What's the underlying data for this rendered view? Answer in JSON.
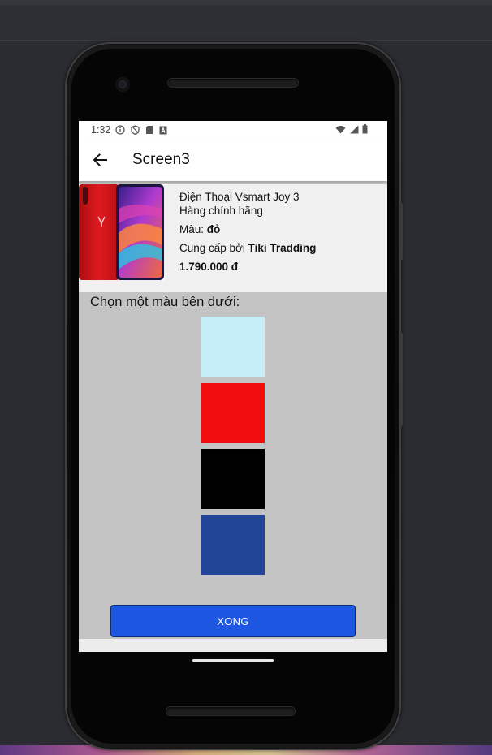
{
  "status_bar": {
    "time": "1:32",
    "left_icons": [
      "info-icon",
      "shield-icon",
      "sd-card-icon",
      "a-badge-icon"
    ],
    "right_icons": [
      "wifi-icon",
      "signal-icon",
      "battery-icon"
    ]
  },
  "app_bar": {
    "title": "Screen3",
    "back_icon": "arrow-left-icon"
  },
  "product": {
    "name": "Điện Thoại Vsmart Joy 3",
    "subtitle": "Hàng chính hãng",
    "color_label": "Màu: ",
    "color_value": "đỏ",
    "supplier_label": "Cung cấp bởi ",
    "supplier_value": "Tiki Tradding",
    "price": "1.790.000 đ"
  },
  "picker": {
    "prompt": "Chọn một màu bên dưới:",
    "swatches": [
      {
        "name": "light-blue",
        "color": "#c6eef9"
      },
      {
        "name": "red",
        "color": "#f10d0e"
      },
      {
        "name": "black",
        "color": "#000000"
      },
      {
        "name": "blue",
        "color": "#234597"
      }
    ]
  },
  "done_button": {
    "label": "XONG",
    "color": "#1c56e1"
  }
}
